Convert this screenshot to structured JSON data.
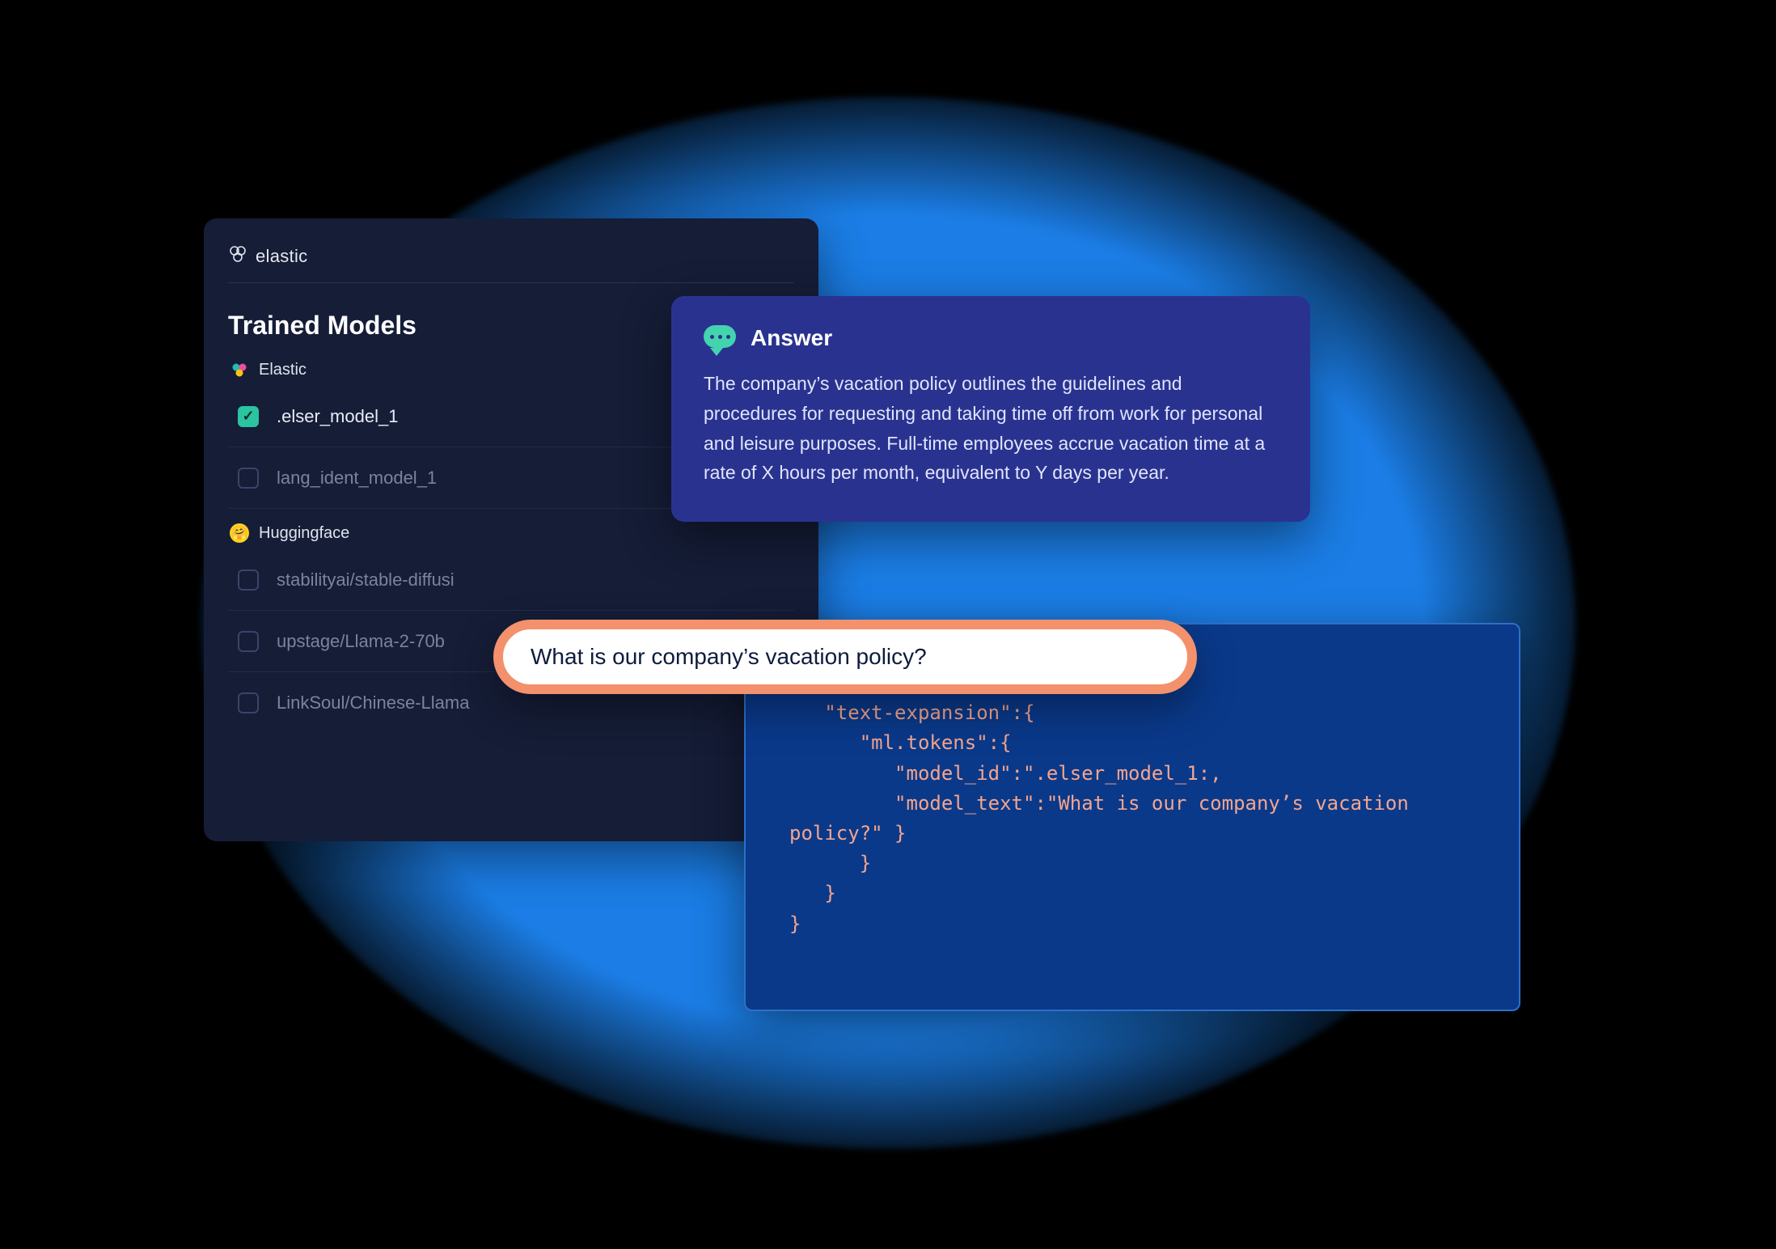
{
  "brand": {
    "name": "elastic"
  },
  "models_panel": {
    "title": "Trained Models",
    "groups": [
      {
        "name": "Elastic",
        "icon": "elastic-cluster-icon",
        "items": [
          {
            "label": ".elser_model_1",
            "checked": true
          },
          {
            "label": "lang_ident_model_1",
            "checked": false
          }
        ]
      },
      {
        "name": "Huggingface",
        "icon": "huggingface-icon",
        "items": [
          {
            "label": "stabilityai/stable-diffusi",
            "checked": false
          },
          {
            "label": "upstage/Llama-2-70b",
            "checked": false
          },
          {
            "label": "LinkSoul/Chinese-Llama",
            "checked": false
          }
        ]
      }
    ]
  },
  "answer_panel": {
    "title": "Answer",
    "body": "The company’s vacation policy outlines the guidelines and procedures for requesting and taking time off from work for personal and leisure purposes. Full-time employees accrue vacation time at a rate of X hours per month, equivalent to Y days per year."
  },
  "search": {
    "value": "What is our company’s vacation policy?"
  },
  "code_panel": {
    "text": "\"query\": {\n   \"text-expansion\":{\n      \"ml.tokens\":{\n         \"model_id\":\".elser_model_1:,\n         \"model_text\":\"What is our company’s vacation policy?\" }\n      }\n   }\n}"
  }
}
